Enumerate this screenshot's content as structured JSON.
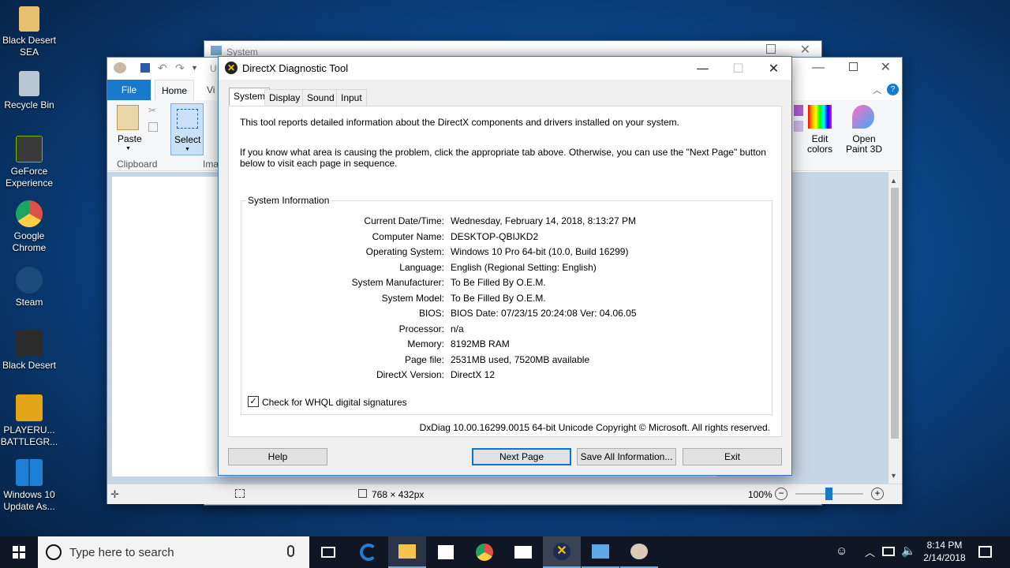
{
  "desktop_icons": [
    {
      "label": "Black Desert SEA",
      "color": "#e8c070"
    },
    {
      "label": "Recycle Bin",
      "color": "#b9c6d4"
    },
    {
      "label": "GeForce Experience",
      "color": "#3a3a3a"
    },
    {
      "label": "Google Chrome",
      "color": "#de5246"
    },
    {
      "label": "Steam",
      "color": "#1b4b7a"
    },
    {
      "label": "Black Desert",
      "color": "#2b2b2b"
    },
    {
      "label": "PLAYERU... BATTLEGR...",
      "color": "#e3a517"
    },
    {
      "label": "Windows 10 Update As...",
      "color": "#1e7fd6"
    }
  ],
  "system_window": {
    "title": "System"
  },
  "paint": {
    "qat_undo_label": "U",
    "tabs": {
      "file": "File",
      "home": "Home",
      "view": "Vi"
    },
    "paste": "Paste",
    "clipboard": "Clipboard",
    "select": "Select",
    "image": "Ima",
    "edit_colors": "Edit colors",
    "open_paint3d": "Open Paint 3D",
    "status_size": "768 × 432px",
    "zoom": "100%"
  },
  "dxdiag": {
    "title": "DirectX Diagnostic Tool",
    "tabs": [
      "System",
      "Display",
      "Sound",
      "Input"
    ],
    "intro1": "This tool reports detailed information about the DirectX components and drivers installed on your system.",
    "intro2": "If you know what area is causing the problem, click the appropriate tab above.  Otherwise, you can use the \"Next Page\" button below to visit each page in sequence.",
    "group_title": "System Information",
    "info": [
      {
        "k": "Current Date/Time:",
        "v": "Wednesday, February 14, 2018, 8:13:27 PM"
      },
      {
        "k": "Computer Name:",
        "v": "DESKTOP-QBIJKD2"
      },
      {
        "k": "Operating System:",
        "v": "Windows 10 Pro 64-bit (10.0, Build 16299)"
      },
      {
        "k": "Language:",
        "v": "English (Regional Setting: English)"
      },
      {
        "k": "System Manufacturer:",
        "v": "To Be Filled By O.E.M."
      },
      {
        "k": "System Model:",
        "v": "To Be Filled By O.E.M."
      },
      {
        "k": "BIOS:",
        "v": "BIOS Date: 07/23/15 20:24:08 Ver: 04.06.05"
      },
      {
        "k": "Processor:",
        "v": "n/a"
      },
      {
        "k": "Memory:",
        "v": "8192MB RAM"
      },
      {
        "k": "Page file:",
        "v": "2531MB used, 7520MB available"
      },
      {
        "k": "DirectX Version:",
        "v": "DirectX 12"
      }
    ],
    "whql_label": "Check for WHQL digital signatures",
    "whql_checked": true,
    "footer": "DxDiag 10.00.16299.0015 64-bit Unicode  Copyright © Microsoft. All rights reserved.",
    "buttons": {
      "help": "Help",
      "next": "Next Page",
      "save": "Save All Information...",
      "exit": "Exit"
    }
  },
  "taskbar": {
    "search_placeholder": "Type here to search",
    "time": "8:14 PM",
    "date": "2/14/2018"
  }
}
